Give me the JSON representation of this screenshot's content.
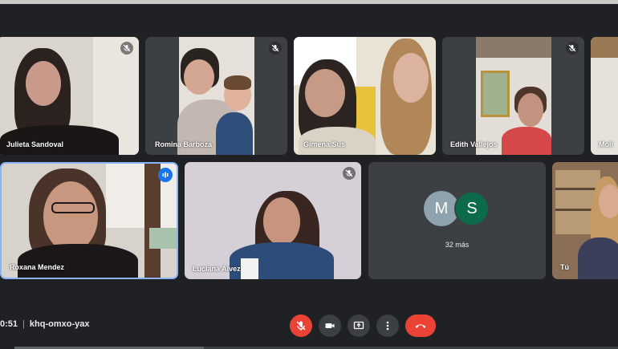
{
  "meeting": {
    "time": "0:51",
    "code": "khq-omxo-yax"
  },
  "participants": [
    {
      "name": "Julieta Sandoval",
      "muted": true
    },
    {
      "name": "Romina Barboza",
      "muted": true
    },
    {
      "name": "Gimena Sus",
      "muted": false
    },
    {
      "name": "Edith Vallejos",
      "muted": true
    },
    {
      "name": "Moli",
      "muted": false
    },
    {
      "name": "Roxana Mendez",
      "speaking": true
    },
    {
      "name": "Luciana Alvez",
      "muted": true
    },
    {
      "name": "Tú",
      "muted": false
    }
  ],
  "overflow": {
    "avatars": [
      {
        "letter": "M",
        "color": "#8ea3ad"
      },
      {
        "letter": "S",
        "color": "#0b6b4a"
      }
    ],
    "label": "32 más"
  },
  "controls": [
    {
      "icon": "mic-off-icon",
      "color": "#ea4335"
    },
    {
      "icon": "camera-icon"
    },
    {
      "icon": "present-icon"
    },
    {
      "icon": "more-vert-icon"
    },
    {
      "icon": "hang-up-icon",
      "color": "#ea4335"
    }
  ],
  "colors": {
    "background": "#202124",
    "tile": "#3c4043",
    "active_border": "#8ab4f8"
  }
}
